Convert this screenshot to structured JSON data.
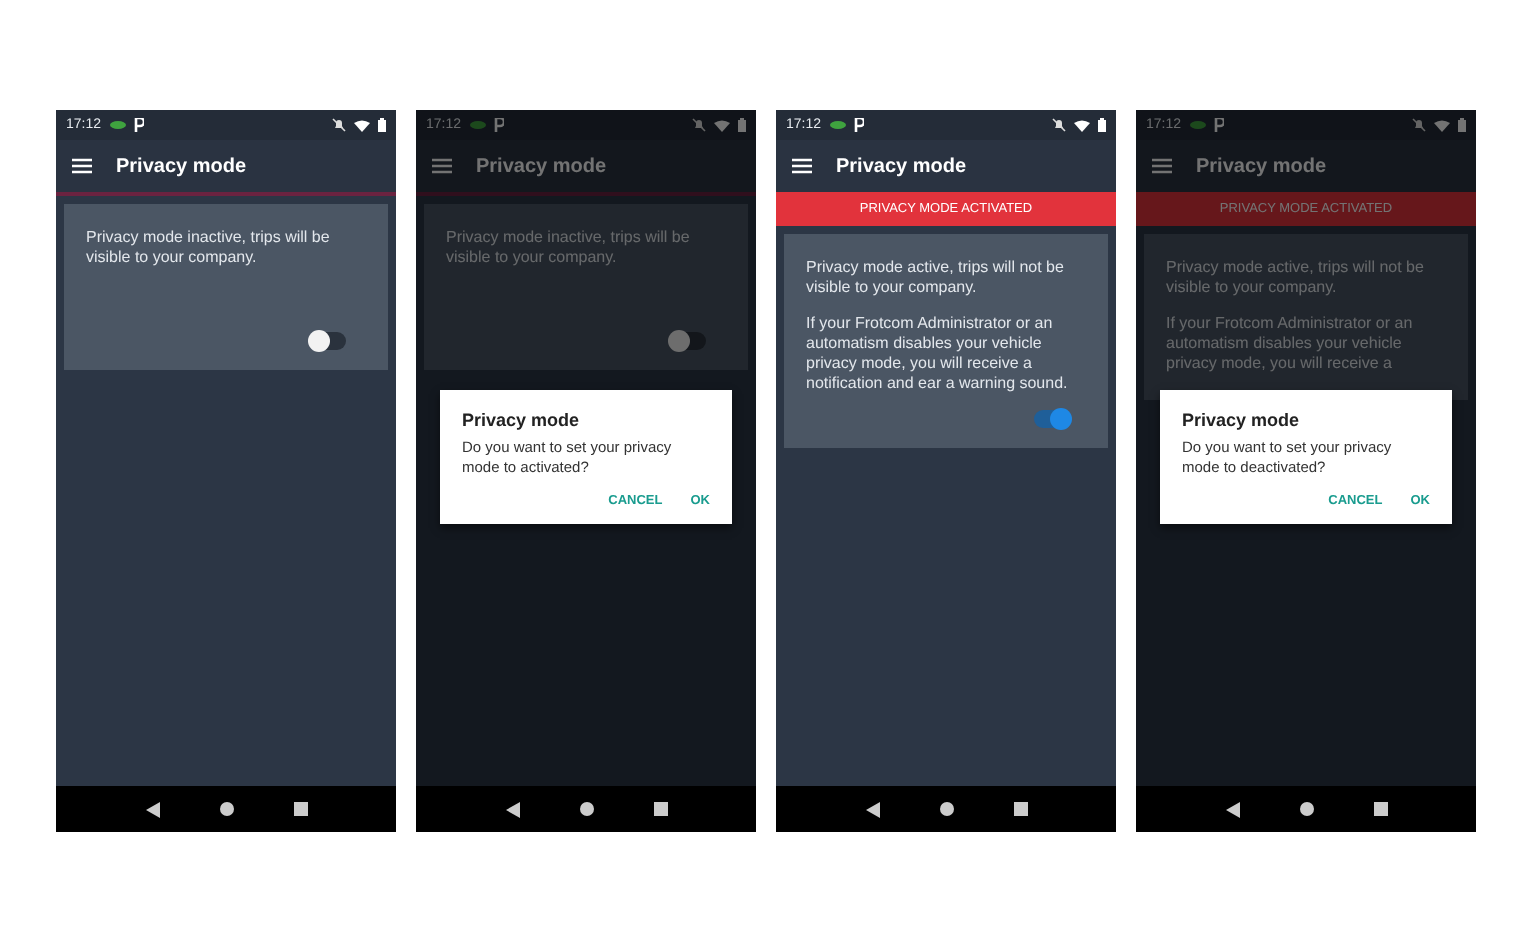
{
  "screens": [
    {
      "status": {
        "time": "17:12"
      },
      "app_bar": {
        "title": "Privacy mode"
      },
      "card": {
        "paragraphs": [
          "Privacy mode inactive, trips will be visible to your company."
        ],
        "toggle": {
          "on": false
        }
      }
    },
    {
      "status": {
        "time": "17:12"
      },
      "app_bar": {
        "title": "Privacy mode"
      },
      "card": {
        "paragraphs": [
          "Privacy mode inactive, trips will be visible to your company."
        ],
        "toggle": {
          "on": false
        }
      },
      "dialog": {
        "title": "Privacy mode",
        "message": "Do you want to set your privacy mode to activated?",
        "buttons": [
          "CANCEL",
          "OK"
        ]
      }
    },
    {
      "status": {
        "time": "17:12"
      },
      "app_bar": {
        "title": "Privacy mode"
      },
      "banner": "PRIVACY MODE ACTIVATED",
      "card": {
        "paragraphs": [
          "Privacy mode active, trips will not be visible to your company.",
          "If your Frotcom Administrator or an automatism disables your vehicle privacy mode, you will receive a notification and ear a warning sound."
        ],
        "toggle": {
          "on": true
        }
      }
    },
    {
      "status": {
        "time": "17:12"
      },
      "app_bar": {
        "title": "Privacy mode"
      },
      "banner": "PRIVACY MODE ACTIVATED",
      "card": {
        "paragraphs": [
          "Privacy mode active, trips will not be visible to your company.",
          "If your Frotcom Administrator or an automatism disables your vehicle privacy mode, you will receive a"
        ]
      },
      "dialog": {
        "title": "Privacy mode",
        "message": "Do you want to set your privacy mode to deactivated?",
        "buttons": [
          "CANCEL",
          "OK"
        ]
      }
    }
  ]
}
